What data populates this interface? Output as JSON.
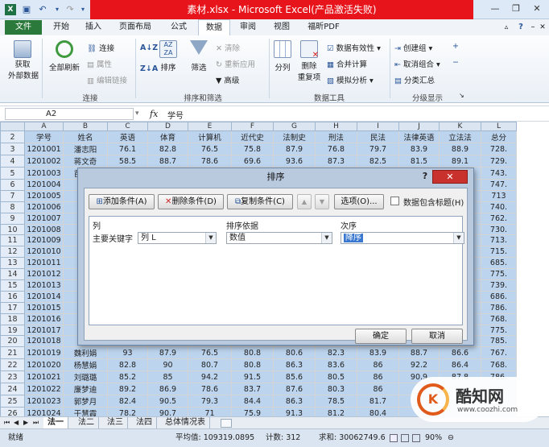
{
  "window": {
    "title": "素材.xlsx - Microsoft Excel(产品激活失败)",
    "minimize": "—",
    "restore": "❐",
    "close": "✕"
  },
  "ribbon_tabs": [
    "文件",
    "开始",
    "插入",
    "页面布局",
    "公式",
    "数据",
    "审阅",
    "视图",
    "福昕PDF"
  ],
  "ribbon": {
    "groups": {
      "get_external": {
        "label": "获取\n外部数据",
        "line1": "获取",
        "line2": "外部数据"
      },
      "connections": {
        "label": "连接",
        "refresh_all": "全部刷新",
        "connections": "连接",
        "properties": "属性",
        "edit_links": "编辑链接"
      },
      "sort_filter": {
        "label": "排序和筛选",
        "sort": "排序",
        "filter": "筛选",
        "clear": "清除",
        "reapply": "重新应用",
        "advanced": "高级"
      },
      "data_tools": {
        "label": "数据工具",
        "split": "分列",
        "remove_dup_1": "删除",
        "remove_dup_2": "重复项",
        "validation": "数据有效性",
        "consolidate": "合并计算",
        "what_if": "模拟分析"
      },
      "outline": {
        "label": "分级显示",
        "group": "创建组",
        "ungroup": "取消组合",
        "subtotal": "分类汇总"
      }
    }
  },
  "formula_bar": {
    "cell_ref": "A2",
    "fx": "fx",
    "value": "学号"
  },
  "columns": [
    "A",
    "B",
    "C",
    "D",
    "E",
    "F",
    "G",
    "H",
    "I",
    "J",
    "K",
    "L"
  ],
  "header_row": [
    "学号",
    "姓名",
    "英语",
    "体育",
    "计算机",
    "近代史",
    "法制史",
    "刑法",
    "民法",
    "法律英语",
    "立法法",
    "总分"
  ],
  "rows": [
    {
      "n": "3",
      "c": [
        "1201001",
        "潘志阳",
        "76.1",
        "82.8",
        "76.5",
        "75.8",
        "87.9",
        "76.8",
        "79.7",
        "83.9",
        "88.9",
        "728."
      ]
    },
    {
      "n": "4",
      "c": [
        "1201002",
        "蒋文奇",
        "58.5",
        "88.7",
        "78.6",
        "69.6",
        "93.6",
        "87.3",
        "82.5",
        "81.5",
        "89.1",
        "729."
      ]
    },
    {
      "n": "5",
      "c": [
        "1201003",
        "苗跃鸣",
        "",
        "",
        "",
        "",
        "",
        "",
        "",
        "",
        "88.3",
        "743."
      ]
    },
    {
      "n": "6",
      "c": [
        "1201004",
        "",
        "",
        "",
        "",
        "",
        "",
        "",
        "",
        "",
        "86.6",
        "747."
      ]
    },
    {
      "n": "7",
      "c": [
        "1201005",
        "",
        "",
        "",
        "",
        "",
        "",
        "",
        "",
        "",
        "88.6",
        "713"
      ]
    },
    {
      "n": "8",
      "c": [
        "1201006",
        "",
        "",
        "",
        "",
        "",
        "",
        "",
        "",
        "",
        "87.2",
        "740."
      ]
    },
    {
      "n": "9",
      "c": [
        "1201007",
        "",
        "",
        "",
        "",
        "",
        "",
        "",
        "",
        "",
        "88.5",
        "762."
      ]
    },
    {
      "n": "10",
      "c": [
        "1201008",
        "",
        "",
        "",
        "",
        "",
        "",
        "",
        "",
        "",
        "90.6",
        "730."
      ]
    },
    {
      "n": "11",
      "c": [
        "1201009",
        "",
        "",
        "",
        "",
        "",
        "",
        "",
        "",
        "",
        "90.3",
        "713."
      ]
    },
    {
      "n": "12",
      "c": [
        "1201010",
        "",
        "",
        "",
        "",
        "",
        "",
        "",
        "",
        "",
        "87.6",
        "715."
      ]
    },
    {
      "n": "13",
      "c": [
        "1201011",
        "",
        "",
        "",
        "",
        "",
        "",
        "",
        "",
        "",
        "88.5",
        "685."
      ]
    },
    {
      "n": "14",
      "c": [
        "1201012",
        "",
        "",
        "",
        "",
        "",
        "",
        "",
        "",
        "",
        "91.7",
        "775."
      ]
    },
    {
      "n": "15",
      "c": [
        "1201013",
        "",
        "",
        "",
        "",
        "",
        "",
        "",
        "",
        "",
        "86.4",
        "739."
      ]
    },
    {
      "n": "16",
      "c": [
        "1201014",
        "",
        "",
        "",
        "",
        "",
        "",
        "",
        "",
        "",
        "87.9",
        "686."
      ]
    },
    {
      "n": "17",
      "c": [
        "1201015",
        "",
        "",
        "",
        "",
        "",
        "",
        "",
        "",
        "",
        "90.7",
        "786."
      ]
    },
    {
      "n": "18",
      "c": [
        "1201016",
        "",
        "",
        "",
        "",
        "",
        "",
        "",
        "",
        "",
        "87.8",
        "768."
      ]
    },
    {
      "n": "19",
      "c": [
        "1201017",
        "",
        "",
        "",
        "",
        "",
        "",
        "",
        "",
        "",
        "90.4",
        "775."
      ]
    },
    {
      "n": "20",
      "c": [
        "1201018",
        "",
        "",
        "",
        "",
        "",
        "",
        "",
        "",
        "",
        "91.4",
        "785."
      ]
    },
    {
      "n": "21",
      "c": [
        "1201019",
        "魏利娟",
        "93",
        "87.9",
        "76.5",
        "80.8",
        "80.6",
        "82.3",
        "83.9",
        "88.7",
        "86.6",
        "767."
      ]
    },
    {
      "n": "22",
      "c": [
        "1201020",
        "杨慧娟",
        "82.8",
        "90",
        "80.7",
        "80.8",
        "86.3",
        "83.6",
        "86",
        "92.2",
        "86.4",
        "768."
      ]
    },
    {
      "n": "23",
      "c": [
        "1201021",
        "刘璐璐",
        "85.2",
        "85",
        "94.2",
        "91.5",
        "85.6",
        "80.5",
        "86",
        "90.9",
        "87.8",
        "786."
      ]
    },
    {
      "n": "24",
      "c": [
        "1201022",
        "廉梦迪",
        "89.2",
        "86.9",
        "78.6",
        "83.7",
        "87.6",
        "80.3",
        "86",
        "",
        "",
        ""
      ]
    },
    {
      "n": "25",
      "c": [
        "1201023",
        "郭梦月",
        "82.4",
        "90.5",
        "79.3",
        "84.4",
        "86.3",
        "78.5",
        "81.7",
        "",
        "",
        ""
      ]
    },
    {
      "n": "26",
      "c": [
        "1201024",
        "于慧霞",
        "78.2",
        "90.7",
        "71",
        "75.9",
        "91.3",
        "81.2",
        "80.4",
        "",
        "",
        ""
      ]
    },
    {
      "n": "27",
      "c": [
        "1201025",
        "",
        "91.4",
        "91.7",
        "79.7",
        "85.1",
        "88.9",
        "83.2",
        "",
        "",
        "",
        ""
      ]
    }
  ],
  "sheet_tabs": [
    "法一",
    "法二",
    "法三",
    "法四",
    "总体情况表"
  ],
  "status": {
    "mode": "就绪",
    "average": "平均值: 109319.0895",
    "count": "计数: 312",
    "sum": "求和: 30062749.6",
    "zoom": "90%"
  },
  "dialog": {
    "title": "排序",
    "help": "?",
    "close": "✕",
    "add_level": "添加条件(A)",
    "delete_level": "删除条件(D)",
    "copy_level": "复制条件(C)",
    "move_up": "▲",
    "move_down": "▼",
    "options": "选项(O)...",
    "has_headers": "数据包含标题(H)",
    "col_header_column": "列",
    "col_header_sort_on": "排序依据",
    "col_header_order": "次序",
    "row_label": "主要关键字",
    "row_column_value": "列 L",
    "row_sort_on_value": "数值",
    "row_order_value": "降序",
    "ok": "确定",
    "cancel": "取消"
  },
  "watermark": {
    "brand": "酷知网",
    "url": "www.coozhi.com",
    "accent": "#e05a1a"
  },
  "colors": {
    "selection": "#bcd4ee",
    "file_tab": "#2b7a3b",
    "title_highlight": "#e8141b",
    "dialog_close": "#c9312d"
  }
}
